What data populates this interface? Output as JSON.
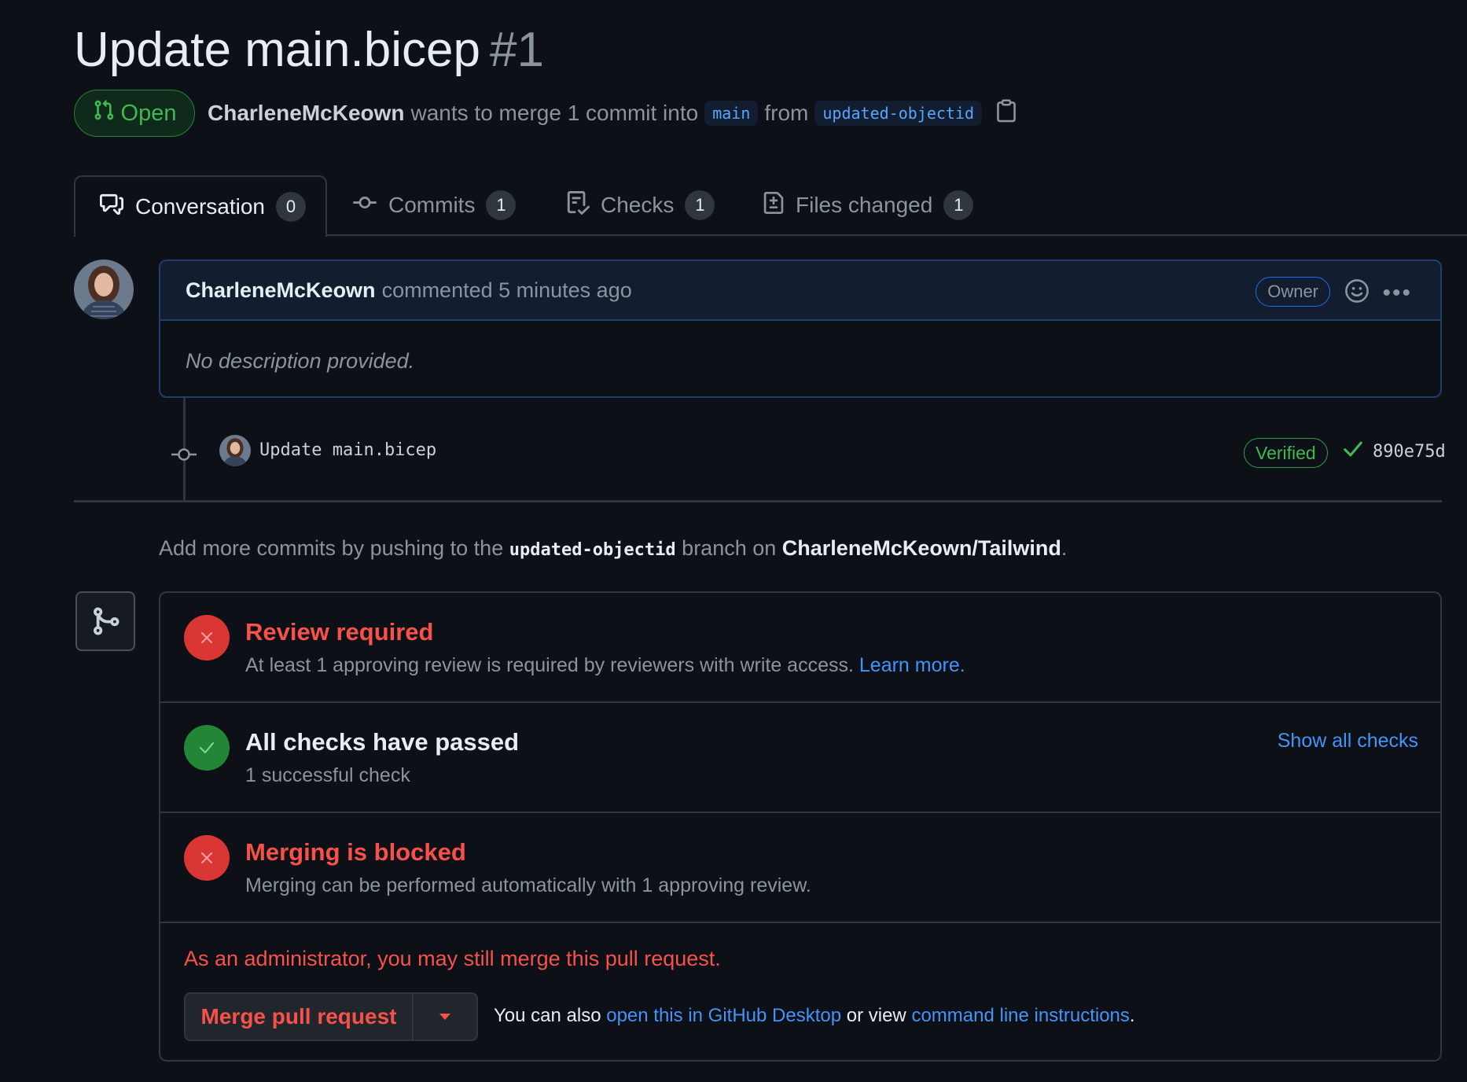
{
  "pr": {
    "title": "Update main.bicep",
    "number": "#1",
    "state": "Open",
    "author": "CharleneMcKeown",
    "merge_text": "wants to merge 1 commit into",
    "base_branch": "main",
    "from_text": "from",
    "head_branch": "updated-objectid"
  },
  "tabs": [
    {
      "label": "Conversation",
      "count": "0"
    },
    {
      "label": "Commits",
      "count": "1"
    },
    {
      "label": "Checks",
      "count": "1"
    },
    {
      "label": "Files changed",
      "count": "1"
    }
  ],
  "comment": {
    "author": "CharleneMcKeown",
    "action": "commented 5 minutes ago",
    "role_badge": "Owner",
    "body": "No description provided."
  },
  "commit": {
    "message": "Update main.bicep",
    "verified": "Verified",
    "sha": "890e75d"
  },
  "hint": {
    "prefix": "Add more commits by pushing to the",
    "branch": "updated-objectid",
    "middle": "branch on",
    "repo": "CharleneMcKeown/Tailwind",
    "suffix": "."
  },
  "merge_box": {
    "review": {
      "title": "Review required",
      "text": "At least 1 approving review is required by reviewers with write access.",
      "link": "Learn more."
    },
    "checks": {
      "title": "All checks have passed",
      "text": "1 successful check",
      "link": "Show all checks"
    },
    "blocked": {
      "title": "Merging is blocked",
      "text": "Merging can be performed automatically with 1 approving review."
    },
    "admin_note": "As an administrator, you may still merge this pull request.",
    "merge_button": "Merge pull request",
    "alt_prefix": "You can also",
    "alt_link1": "open this in GitHub Desktop",
    "alt_middle": "or view",
    "alt_link2": "command line instructions",
    "alt_suffix": "."
  },
  "colors": {
    "background": "#0d1117",
    "open_green": "#3fb950",
    "danger_red": "#f85149",
    "link_blue": "#4493f8",
    "border": "#30363d"
  }
}
